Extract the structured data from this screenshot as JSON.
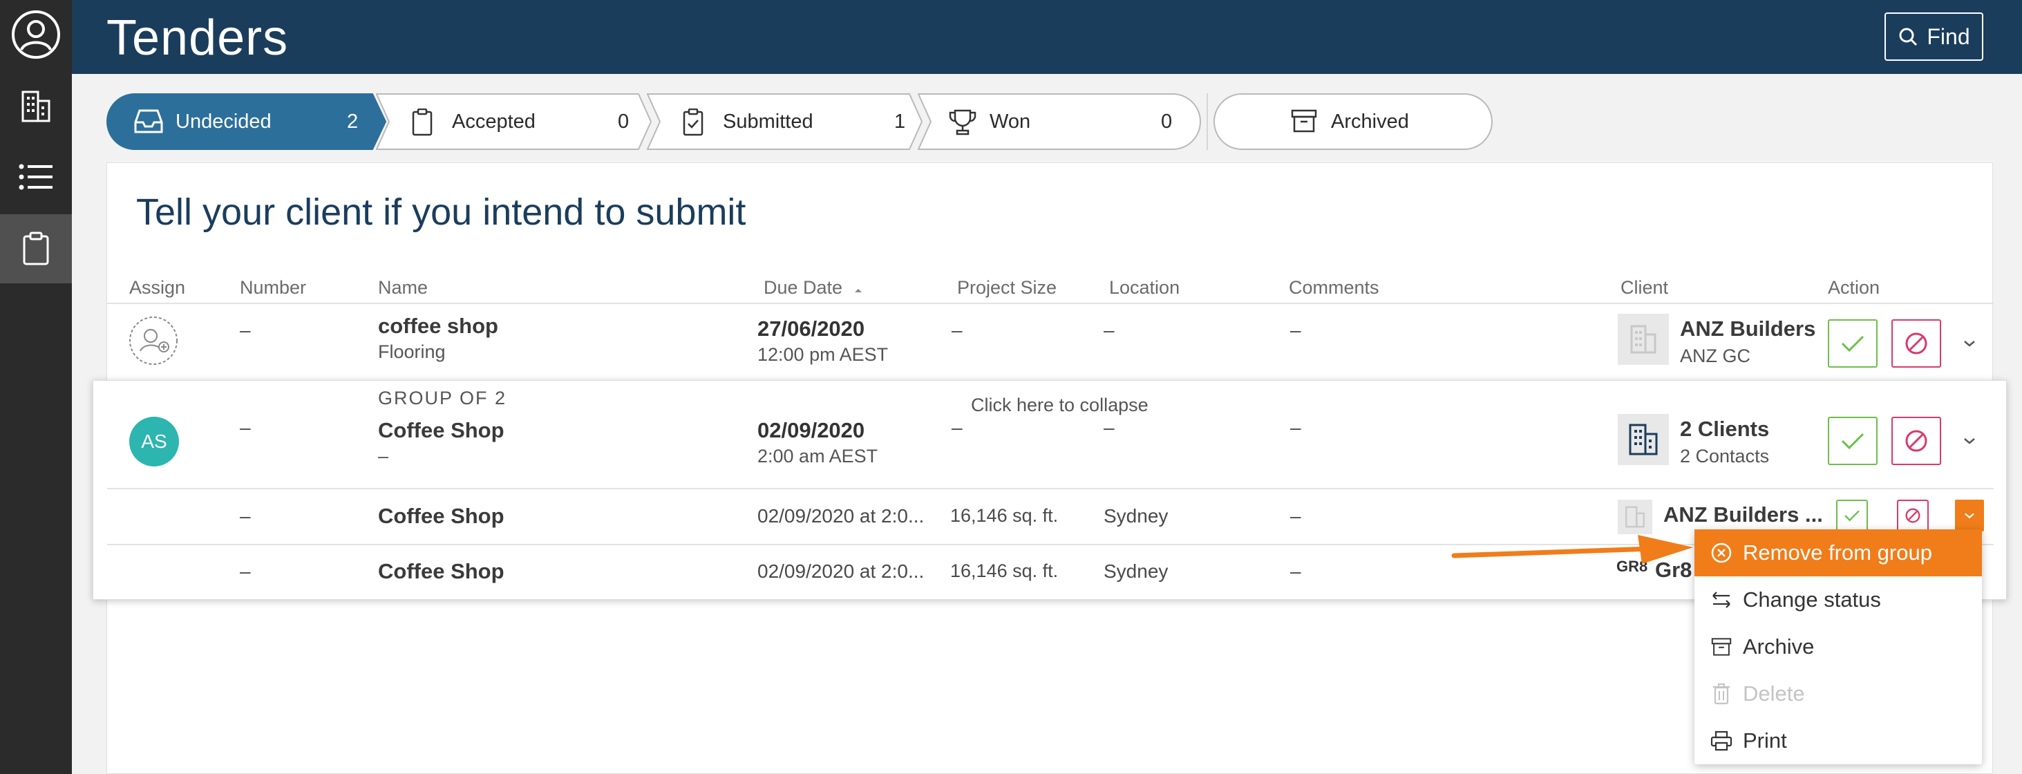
{
  "sidebar": {
    "items": [
      {
        "icon": "user-circle-icon"
      },
      {
        "icon": "building-icon"
      },
      {
        "icon": "list-icon"
      },
      {
        "icon": "clipboard-icon"
      }
    ]
  },
  "header": {
    "title": "Tenders",
    "find_label": "Find"
  },
  "tabs": [
    {
      "label": "Undecided",
      "count": "2",
      "icon": "inbox-icon",
      "active": true
    },
    {
      "label": "Accepted",
      "count": "0",
      "icon": "clipboard-icon"
    },
    {
      "label": "Submitted",
      "count": "1",
      "icon": "clipboard-check-icon"
    },
    {
      "label": "Won",
      "count": "0",
      "icon": "trophy-icon"
    },
    {
      "label": "Archived",
      "icon": "archive-icon"
    }
  ],
  "card": {
    "title": "Tell your client if you intend to submit"
  },
  "columns": {
    "assign": "Assign",
    "number": "Number",
    "name": "Name",
    "due_date": "Due Date",
    "project_size": "Project Size",
    "location": "Location",
    "comments": "Comments",
    "client": "Client",
    "action": "Action"
  },
  "rows": [
    {
      "number": "–",
      "name": "coffee shop",
      "trade": "Flooring",
      "due_date": "27/06/2020",
      "due_time": "12:00 pm AEST",
      "project_size": "–",
      "location": "–",
      "comments": "–",
      "client_name": "ANZ Builders",
      "client_sub": "ANZ GC"
    }
  ],
  "group": {
    "group_label": "GROUP OF 2",
    "collapse_hint": "Click here to collapse",
    "avatar_initials": "AS",
    "number": "–",
    "name": "Coffee Shop",
    "trade": "–",
    "due_date": "02/09/2020",
    "due_time": "2:00 am AEST",
    "project_size": "–",
    "location": "–",
    "comments": "–",
    "client_name": "2 Clients",
    "client_sub": "2 Contacts",
    "children": [
      {
        "number": "–",
        "name": "Coffee Shop",
        "due": "02/09/2020 at 2:0...",
        "project_size": "16,146 sq. ft.",
        "location": "Sydney",
        "comments": "–",
        "client_name": "ANZ Builders ..."
      },
      {
        "number": "–",
        "name": "Coffee Shop",
        "due": "02/09/2020 at 2:0...",
        "project_size": "16,146 sq. ft.",
        "location": "Sydney",
        "comments": "–",
        "client_name": "Gr8",
        "client_logo_text": "GR8"
      }
    ]
  },
  "menu": {
    "items": [
      {
        "label": "Remove from group",
        "icon": "x-circle-icon"
      },
      {
        "label": "Change status",
        "icon": "swap-arrows-icon"
      },
      {
        "label": "Archive",
        "icon": "archive-icon"
      },
      {
        "label": "Delete",
        "icon": "trash-icon"
      },
      {
        "label": "Print",
        "icon": "printer-icon"
      }
    ]
  },
  "colors": {
    "header_bg": "#1b3d5c",
    "active_tab": "#2d6f9b",
    "accept_green": "#6cbf4a",
    "decline_red": "#d93a6b",
    "highlight_orange": "#f07d1a",
    "avatar_teal": "#2db5b0"
  }
}
